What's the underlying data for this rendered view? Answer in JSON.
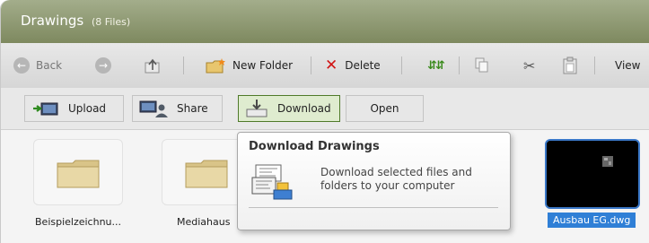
{
  "window": {
    "title": "Drawings",
    "file_count": "(8 Files)"
  },
  "toolbar": {
    "back_label": "Back",
    "new_folder_label": "New Folder",
    "delete_label": "Delete",
    "view_label": "View"
  },
  "actions": {
    "upload_label": "Upload",
    "share_label": "Share",
    "download_label": "Download",
    "open_label": "Open"
  },
  "tooltip": {
    "title": "Download Drawings",
    "description": "Download selected files and folders to your computer"
  },
  "files": [
    {
      "name": "Beispielzeichnu...",
      "type": "folder"
    },
    {
      "name": "Mediahaus",
      "type": "folder"
    },
    {
      "name": "Ausbau EG.dwg",
      "type": "dwg",
      "selected": true
    }
  ],
  "colors": {
    "title_bar": "#8f9a70",
    "selection_blue": "#2f7fd6",
    "delete_red": "#d11414",
    "refresh_green": "#3a8a1c"
  }
}
